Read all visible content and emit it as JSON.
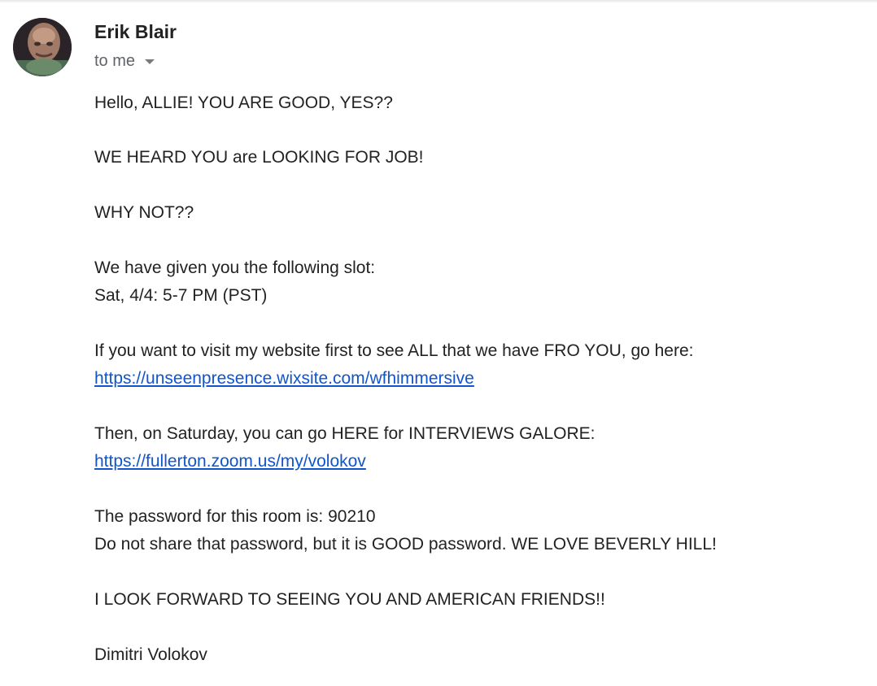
{
  "sender": {
    "name": "Erik Blair",
    "recipient": "to me"
  },
  "body": {
    "greeting": "Hello, ALLIE! YOU ARE GOOD, YES??",
    "heard": "WE HEARD YOU are LOOKING FOR JOB!",
    "why_not": "WHY NOT??",
    "slot_intro": "We have given you the following slot:",
    "slot_time": "Sat, 4/4: 5-7 PM (PST)",
    "website_intro": "If you want to visit my website first to see ALL that we have FRO YOU, go here:",
    "website_link": "https://unseenpresence.wixsite.com/wfhimmersive",
    "interview_intro": "Then, on Saturday, you can go HERE for INTERVIEWS GALORE:",
    "zoom_link": "https://fullerton.zoom.us/my/volokov",
    "password_line": "The password for this room is: 90210",
    "password_note": "Do not share that password, but it is GOOD password. WE LOVE BEVERLY HILL!",
    "closing": "I LOOK FORWARD TO SEEING YOU AND AMERICAN FRIENDS!!",
    "signature": "Dimitri Volokov"
  },
  "colors": {
    "text": "#222222",
    "secondary_text": "#5f6368",
    "link": "#1155cc"
  },
  "icons": {
    "avatar": "sender-photo",
    "recipient_caret": "chevron-down-icon"
  }
}
